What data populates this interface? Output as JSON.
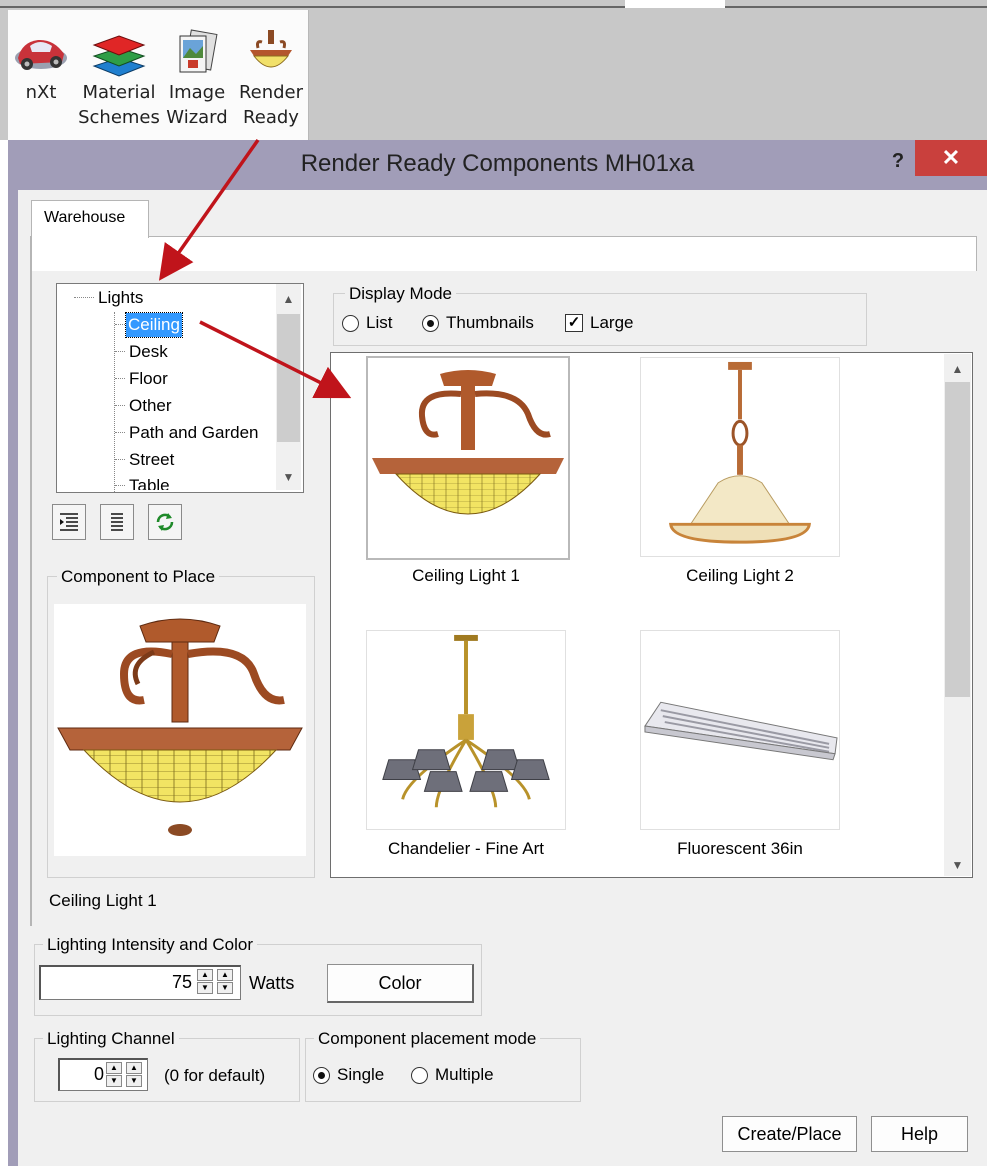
{
  "ribbon": {
    "buttons": [
      {
        "label": "nXt",
        "icon": "car-icon"
      },
      {
        "label": "Material\nSchemes",
        "icon": "layers-icon"
      },
      {
        "label": "Image\nWizard",
        "icon": "image-wizard-icon"
      },
      {
        "label": "Render\nReady",
        "icon": "ceiling-lamp-icon"
      }
    ]
  },
  "dialog": {
    "title": "Render Ready Components MH01xa",
    "help": "?",
    "close": "✕"
  },
  "tabs": [
    "Warehouse"
  ],
  "tree": {
    "root": "Lights",
    "items": [
      "Ceiling",
      "Desk",
      "Floor",
      "Other",
      "Path and Garden",
      "Street",
      "Table"
    ],
    "selected": "Ceiling"
  },
  "display_mode": {
    "label": "Display Mode",
    "options": [
      {
        "label": "List",
        "checked": false
      },
      {
        "label": "Thumbnails",
        "checked": true
      }
    ],
    "large": {
      "label": "Large",
      "checked": true
    }
  },
  "thumbnails": [
    {
      "label": "Ceiling Light 1",
      "selected": true
    },
    {
      "label": "Ceiling Light 2",
      "selected": false
    },
    {
      "label": "Chandelier - Fine Art",
      "selected": false
    },
    {
      "label": "Fluorescent 36in",
      "selected": false
    }
  ],
  "component": {
    "group_label": "Component to Place",
    "name": "Ceiling Light 1"
  },
  "intensity": {
    "group_label": "Lighting Intensity and Color",
    "value": "75",
    "unit": "Watts",
    "color_button": "Color"
  },
  "channel": {
    "group_label": "Lighting Channel",
    "value": "0",
    "hint": "(0 for default)"
  },
  "placement": {
    "group_label": "Component placement mode",
    "options": [
      {
        "label": "Single",
        "checked": true
      },
      {
        "label": "Multiple",
        "checked": false
      }
    ]
  },
  "buttons": {
    "create": "Create/Place",
    "help": "Help"
  },
  "colors": {
    "title_bar": "#a19db8",
    "close": "#c9403d",
    "selection": "#3399ff",
    "annotation_arrow": "#c0141b"
  }
}
